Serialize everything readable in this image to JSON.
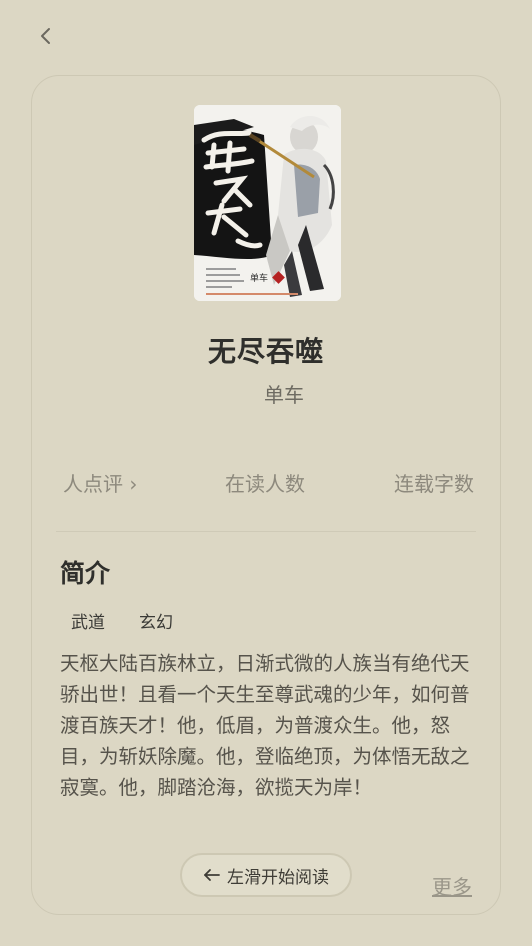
{
  "nav": {
    "back_icon": "chevron-left-icon"
  },
  "book": {
    "title": "无尽吞噬",
    "author": "单车",
    "cover": {
      "calligraphy": "無盡吞噬",
      "author_mark": "单车"
    }
  },
  "stats": {
    "rating": "人点评 ›",
    "readers": "在读人数",
    "words": "连载字数"
  },
  "intro": {
    "heading": "简介",
    "tags": [
      "武道",
      "玄幻"
    ],
    "text": "天枢大陆百族林立，日渐式微的人族当有绝代天骄出世！且看一个天生至尊武魂的少年，如何普渡百族天才！他，低眉，为普渡众生。他，怒目，为斩妖除魔。他，登临绝顶，为体悟无敌之寂寞。他，脚踏沧海，欲揽天为岸！"
  },
  "actions": {
    "start_reading": "左滑开始阅读",
    "more": "更多"
  },
  "colors": {
    "background": "#dcd7c4",
    "title": "#2f2f2c",
    "muted": "#8d897d",
    "cover_seal": "#b52222"
  }
}
